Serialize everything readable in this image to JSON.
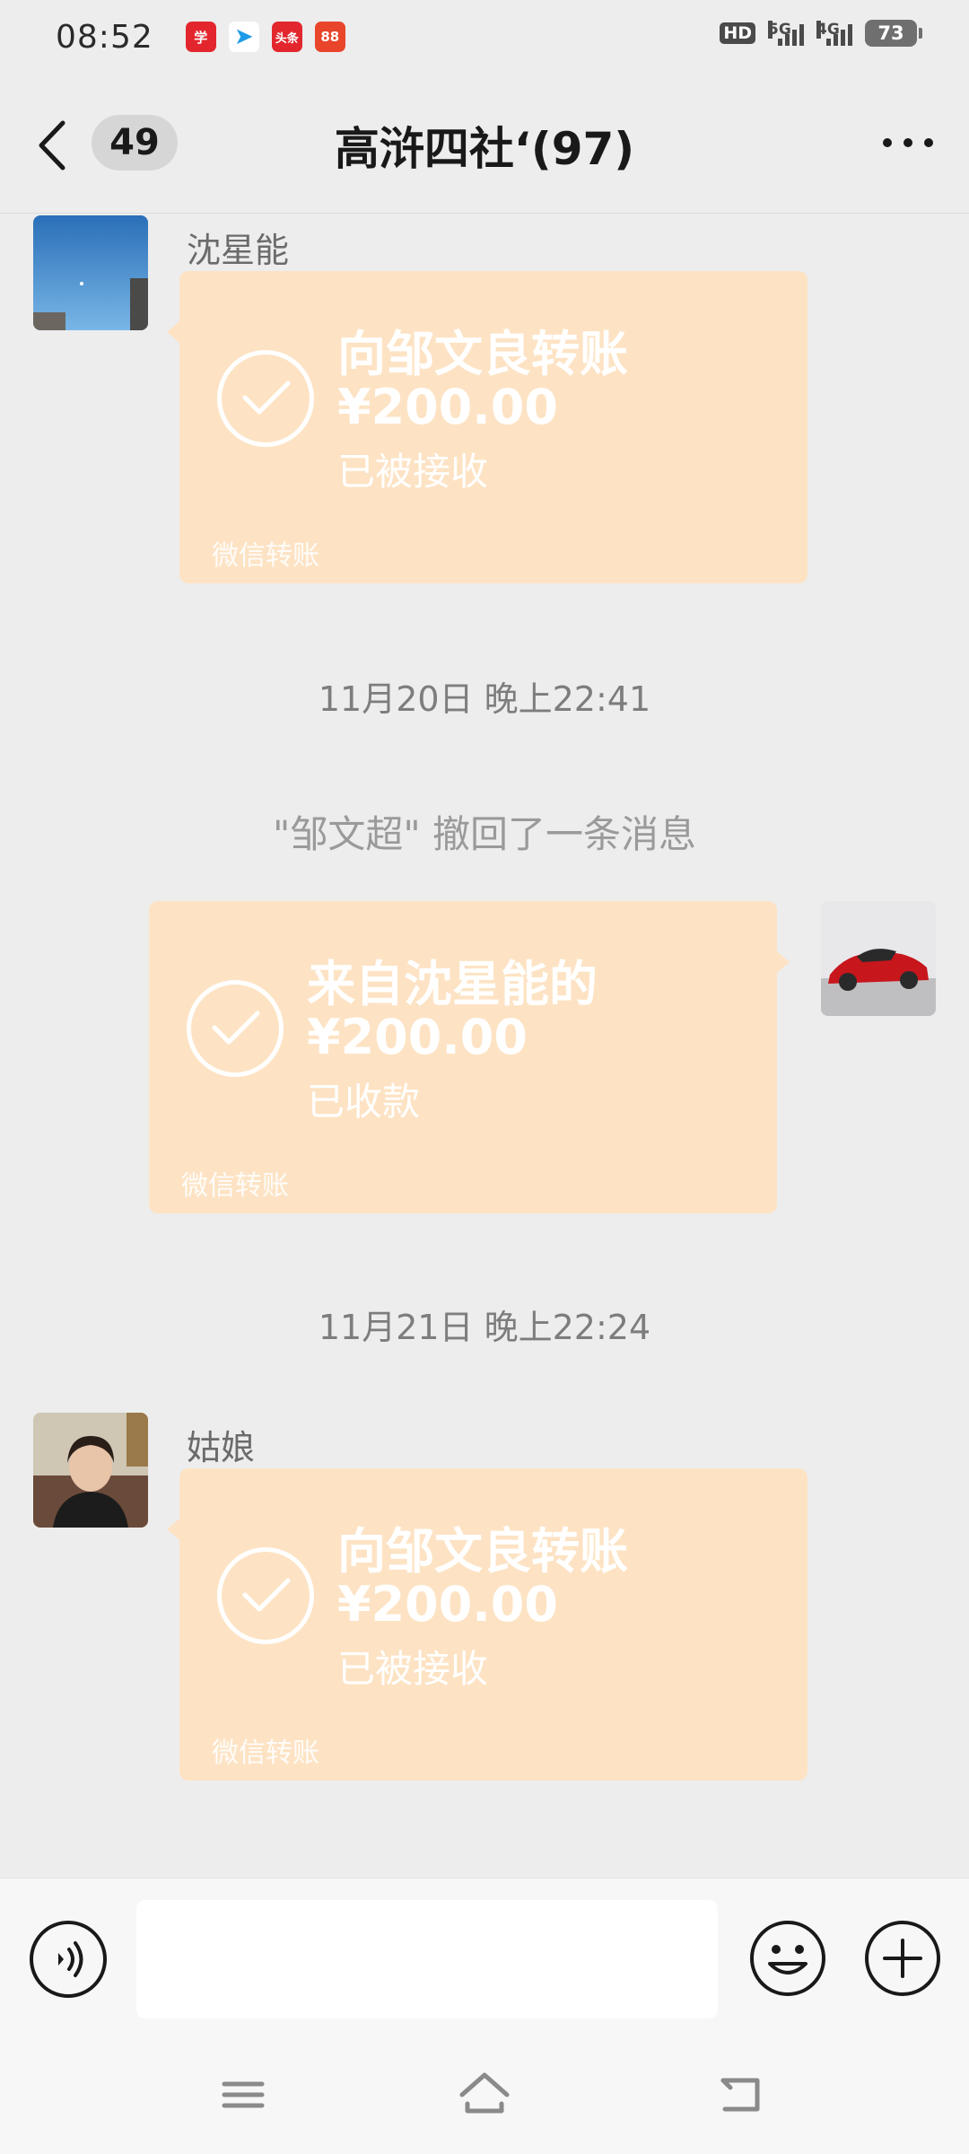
{
  "status_bar": {
    "time": "08:52",
    "notification_icons": [
      {
        "name": "app-red-icon",
        "color": "#e3262d",
        "glyph": "学"
      },
      {
        "name": "paper-plane-icon",
        "color": "#1e9be8",
        "glyph": "➤"
      },
      {
        "name": "toutiao-icon",
        "color": "#e3262d",
        "glyph": "头条"
      },
      {
        "name": "app-orange-icon",
        "color": "#e8452b",
        "glyph": "88"
      }
    ],
    "hd_label": "HD",
    "signal_1_label": "5G",
    "signal_2_label": "4G",
    "battery": "73"
  },
  "title_bar": {
    "unread_count": "49",
    "title": "高浒四社‘(97)"
  },
  "messages": [
    {
      "sender": "沈星能",
      "title": "向邹文良转账",
      "amount": "¥200.00",
      "status": "已被接收",
      "footer": "微信转账"
    },
    {
      "timestamp": "11月20日 晚上22:41"
    },
    {
      "system_text": "\"邹文超\" 撤回了一条消息"
    },
    {
      "title": "来自沈星能的",
      "amount": "¥200.00",
      "status": "已收款",
      "footer": "微信转账"
    },
    {
      "timestamp": "11月21日 晚上22:24"
    },
    {
      "sender": "姑娘",
      "title": "向邹文良转账",
      "amount": "¥200.00",
      "status": "已被接收",
      "footer": "微信转账"
    }
  ],
  "colors": {
    "transfer_bubble": "#fde3c4",
    "background": "#ededed"
  }
}
